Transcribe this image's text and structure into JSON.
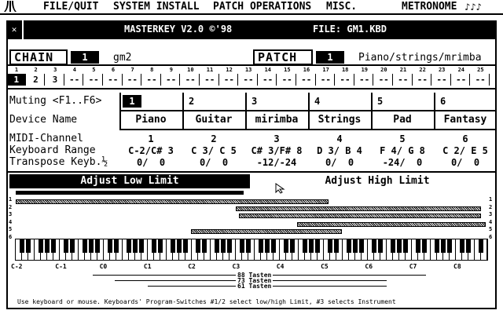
{
  "menu": {
    "atari_logo": "atari-fuji-icon",
    "file": "FILE/QUIT",
    "system": "SYSTEM INSTALL",
    "patch": "PATCH OPERATIONS",
    "misc": "MISC.",
    "metronome": "METRONOME",
    "metronome_icon": "♪♪♪"
  },
  "window": {
    "close": "✕",
    "app_title": "MASTERKEY V2.0 ©'98",
    "file_label": "FILE: GM1.KBD"
  },
  "chain": {
    "label": "CHAIN",
    "number": "1",
    "name": "gm2"
  },
  "patch": {
    "label": "PATCH",
    "number": "1",
    "name": "Piano/strings/mrimba"
  },
  "chain_slots": {
    "numbers": [
      "1",
      "2",
      "3",
      "4",
      "5",
      "6",
      "7",
      "8",
      "9",
      "10",
      "11",
      "12",
      "13",
      "14",
      "15",
      "16",
      "17",
      "18",
      "19",
      "20",
      "21",
      "22",
      "23",
      "24",
      "25"
    ],
    "values": [
      "1",
      "2",
      "3",
      "--",
      "--",
      "--",
      "--",
      "--",
      "--",
      "--",
      "--",
      "--",
      "--",
      "--",
      "--",
      "--",
      "--",
      "--",
      "--",
      "--",
      "--",
      "--",
      "--",
      "--",
      "--"
    ]
  },
  "labels": {
    "muting": "Muting <F1..F6>",
    "device": "Device Name",
    "midi": "MIDI-Channel",
    "range": "Keyboard Range",
    "transpose": "Transpose Keyb.½"
  },
  "devices": [
    {
      "mute": "1",
      "name": "Piano",
      "midi": "1",
      "range": "C-2/C# 3",
      "transpose": "0/  0"
    },
    {
      "mute": "2",
      "name": "Guitar",
      "midi": "2",
      "range": "C 3/ C 5",
      "transpose": "0/  0"
    },
    {
      "mute": "3",
      "name": "mirimba",
      "midi": "3",
      "range": "C# 3/F# 8",
      "transpose": "-12/-24"
    },
    {
      "mute": "4",
      "name": "Strings",
      "midi": "4",
      "range": "D 3/ B 4",
      "transpose": "0/  0"
    },
    {
      "mute": "5",
      "name": "Pad",
      "midi": "5",
      "range": "F 4/ G 8",
      "transpose": "-24/  0"
    },
    {
      "mute": "6",
      "name": "Fantasy",
      "midi": "6",
      "range": "C 2/ E 5",
      "transpose": "0/  0"
    }
  ],
  "limits": {
    "low": "Adjust Low Limit",
    "high": "Adjust High Limit",
    "row_numbers": [
      "1",
      "2",
      "3",
      "4",
      "5",
      "6"
    ]
  },
  "octaves": [
    "C-2",
    "C-1",
    "C0",
    "C1",
    "C2",
    "C3",
    "C4",
    "C5",
    "C6",
    "C7",
    "C8"
  ],
  "ranges": {
    "r88": "88 Tasten",
    "r73": "73 Tasten",
    "r61": "61 Tasten"
  },
  "footer": "Use keyboard or mouse. Keyboards' Program-Switches #1/2 select low/high Limit, #3 selects Instrument"
}
